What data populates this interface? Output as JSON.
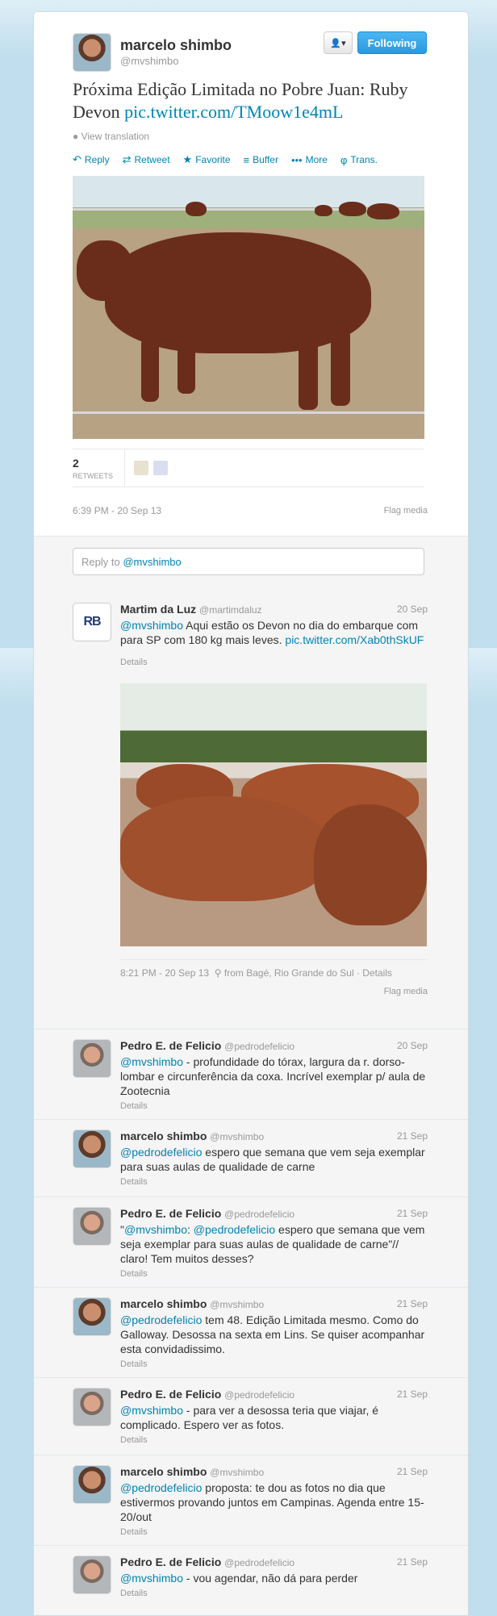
{
  "main_tweet": {
    "name": "marcelo shimbo",
    "handle": "@mvshimbo",
    "follow_label": "Following",
    "user_menu_icon": "person-dropdown-icon",
    "text": "Próxima Edição Limitada no Pobre Juan: Ruby Devon ",
    "link": "pic.twitter.com/TMoow1e4mL",
    "view_translation": "View translation",
    "actions": [
      {
        "label": "Reply",
        "icon": "reply-icon"
      },
      {
        "label": "Retweet",
        "icon": "retweet-icon"
      },
      {
        "label": "Favorite",
        "icon": "star-icon"
      },
      {
        "label": "Buffer",
        "icon": "buffer-icon"
      },
      {
        "label": "More",
        "icon": "more-icon"
      },
      {
        "label": "Trans.",
        "icon": "translate-icon"
      }
    ],
    "retweets_count": "2",
    "retweets_label": "RETWEETS",
    "timestamp": "6:39 PM - 20 Sep 13",
    "flag_media": "Flag media"
  },
  "reply_box": {
    "prefix": "Reply to ",
    "handle": "@mvshimbo"
  },
  "replies": [
    {
      "name": "Martim da Luz",
      "handle": "@martimdaluz",
      "date": "20 Sep",
      "mention": "@mvshimbo",
      "text": " Aqui estão os Devon no dia do embarque com para SP com 180 kg mais leves. ",
      "link": "pic.twitter.com/Xab0thSkUF",
      "details": "Details",
      "timestamp": "8:21 PM - 20 Sep 13",
      "location": "from Bagé, Rio Grande do Sul · Details",
      "flag_media": "Flag media"
    },
    {
      "name": "Pedro E. de Felicio",
      "handle": "@pedrodefelicio",
      "date": "20 Sep",
      "mention": "@mvshimbo",
      "text": " - profundidade do tórax, largura da r. dorso-lombar e circunferência da coxa. Incrível exemplar p/ aula de Zootecnia",
      "details": "Details"
    },
    {
      "name": "marcelo shimbo",
      "handle": "@mvshimbo",
      "date": "21 Sep",
      "mention": "@pedrodefelicio",
      "text": " espero que semana que vem seja exemplar para suas aulas de qualidade de carne",
      "details": "Details"
    },
    {
      "name": "Pedro E. de Felicio",
      "handle": "@pedrodefelicio",
      "date": "21 Sep",
      "pre": "\"",
      "mention": "@mvshimbo",
      "mid": ": ",
      "mention2": "@pedrodefelicio",
      "text": " espero que semana que vem seja exemplar para suas aulas de qualidade de carne\"// claro! Tem muitos desses?",
      "details": "Details"
    },
    {
      "name": "marcelo shimbo",
      "handle": "@mvshimbo",
      "date": "21 Sep",
      "mention": "@pedrodefelicio",
      "text": " tem 48. Edição Limitada mesmo. Como do Galloway. Desossa na sexta em Lins. Se quiser acompanhar esta convidadissimo.",
      "details": "Details"
    },
    {
      "name": "Pedro E. de Felicio",
      "handle": "@pedrodefelicio",
      "date": "21 Sep",
      "mention": "@mvshimbo",
      "text": " - para ver a desossa teria que viajar, é complicado. Espero ver as fotos.",
      "details": "Details"
    },
    {
      "name": "marcelo shimbo",
      "handle": "@mvshimbo",
      "date": "21 Sep",
      "mention": "@pedrodefelicio",
      "text": " proposta: te dou as fotos no dia que estivermos provando juntos em Campinas. Agenda entre 15-20/out",
      "details": "Details"
    },
    {
      "name": "Pedro E. de Felicio",
      "handle": "@pedrodefelicio",
      "date": "21 Sep",
      "mention": "@mvshimbo",
      "text": " - vou agendar, não dá para perder",
      "details": "Details"
    }
  ]
}
